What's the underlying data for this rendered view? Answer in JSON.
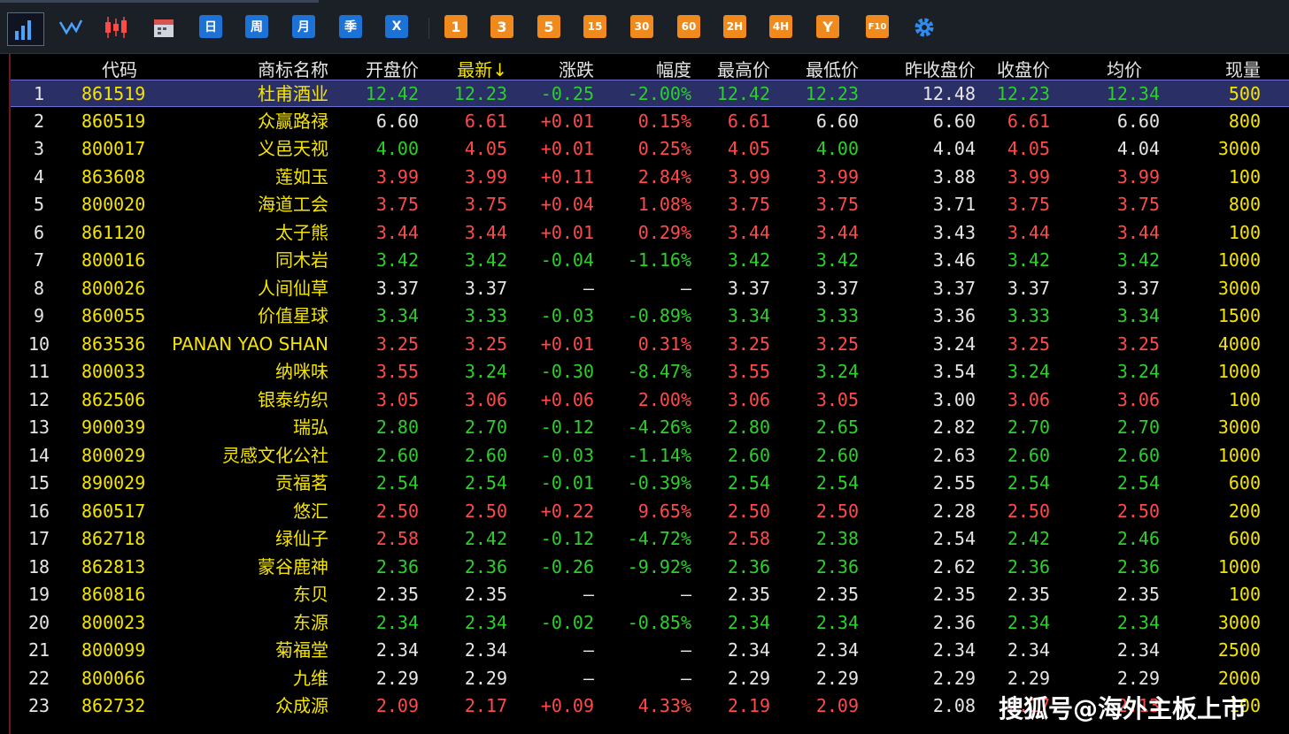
{
  "toolbar": {
    "buttons_blue": [
      "日",
      "周",
      "月",
      "季",
      "X"
    ],
    "buttons_orange": [
      "1",
      "3",
      "5",
      "15",
      "30",
      "60",
      "2H",
      "4H",
      "Y",
      "F10"
    ]
  },
  "headers": [
    "代码",
    "商标名称",
    "开盘价",
    "最新↓",
    "涨跌",
    "幅度",
    "最高价",
    "最低价",
    "昨收盘价",
    "收盘价",
    "均价",
    "现量"
  ],
  "colors": {
    "up": "#ff4a4a",
    "down": "#2bd02b",
    "flat": "#e6e6e6",
    "code": "#f5e400",
    "selected_bg": "#2a2f66"
  },
  "rows": [
    {
      "n": "1",
      "code": "861519",
      "name": "杜甫酒业",
      "open": "12.42",
      "last": "12.23",
      "chg": "-0.25",
      "pct": "-2.00%",
      "high": "12.42",
      "low": "12.23",
      "prev": "12.48",
      "close": "12.23",
      "avg": "12.34",
      "vol": "500",
      "open_c": "down",
      "last_c": "down",
      "chg_c": "down",
      "high_c": "down",
      "low_c": "down",
      "close_c": "down",
      "avg_c": "down"
    },
    {
      "n": "2",
      "code": "860519",
      "name": "众赢路禄",
      "open": "6.60",
      "last": "6.61",
      "chg": "+0.01",
      "pct": "0.15%",
      "high": "6.61",
      "low": "6.60",
      "prev": "6.60",
      "close": "6.61",
      "avg": "6.60",
      "vol": "800",
      "open_c": "flat",
      "last_c": "up",
      "chg_c": "up",
      "high_c": "up",
      "low_c": "flat",
      "close_c": "up",
      "avg_c": "flat"
    },
    {
      "n": "3",
      "code": "800017",
      "name": "义邑天视",
      "open": "4.00",
      "last": "4.05",
      "chg": "+0.01",
      "pct": "0.25%",
      "high": "4.05",
      "low": "4.00",
      "prev": "4.04",
      "close": "4.05",
      "avg": "4.04",
      "vol": "3000",
      "open_c": "down",
      "last_c": "up",
      "chg_c": "up",
      "high_c": "up",
      "low_c": "down",
      "close_c": "up",
      "avg_c": "flat"
    },
    {
      "n": "4",
      "code": "863608",
      "name": "莲如玉",
      "open": "3.99",
      "last": "3.99",
      "chg": "+0.11",
      "pct": "2.84%",
      "high": "3.99",
      "low": "3.99",
      "prev": "3.88",
      "close": "3.99",
      "avg": "3.99",
      "vol": "100",
      "open_c": "up",
      "last_c": "up",
      "chg_c": "up",
      "high_c": "up",
      "low_c": "up",
      "close_c": "up",
      "avg_c": "up"
    },
    {
      "n": "5",
      "code": "800020",
      "name": "海道工会",
      "open": "3.75",
      "last": "3.75",
      "chg": "+0.04",
      "pct": "1.08%",
      "high": "3.75",
      "low": "3.75",
      "prev": "3.71",
      "close": "3.75",
      "avg": "3.75",
      "vol": "800",
      "open_c": "up",
      "last_c": "up",
      "chg_c": "up",
      "high_c": "up",
      "low_c": "up",
      "close_c": "up",
      "avg_c": "up"
    },
    {
      "n": "6",
      "code": "861120",
      "name": "太子熊",
      "open": "3.44",
      "last": "3.44",
      "chg": "+0.01",
      "pct": "0.29%",
      "high": "3.44",
      "low": "3.44",
      "prev": "3.43",
      "close": "3.44",
      "avg": "3.44",
      "vol": "100",
      "open_c": "up",
      "last_c": "up",
      "chg_c": "up",
      "high_c": "up",
      "low_c": "up",
      "close_c": "up",
      "avg_c": "up"
    },
    {
      "n": "7",
      "code": "800016",
      "name": "同木岩",
      "open": "3.42",
      "last": "3.42",
      "chg": "-0.04",
      "pct": "-1.16%",
      "high": "3.42",
      "low": "3.42",
      "prev": "3.46",
      "close": "3.42",
      "avg": "3.42",
      "vol": "1000",
      "open_c": "down",
      "last_c": "down",
      "chg_c": "down",
      "high_c": "down",
      "low_c": "down",
      "close_c": "down",
      "avg_c": "down"
    },
    {
      "n": "8",
      "code": "800026",
      "name": "人间仙草",
      "open": "3.37",
      "last": "3.37",
      "chg": "—",
      "pct": "—",
      "high": "3.37",
      "low": "3.37",
      "prev": "3.37",
      "close": "3.37",
      "avg": "3.37",
      "vol": "3000",
      "open_c": "flat",
      "last_c": "flat",
      "chg_c": "flat",
      "high_c": "flat",
      "low_c": "flat",
      "close_c": "flat",
      "avg_c": "flat"
    },
    {
      "n": "9",
      "code": "860055",
      "name": "价值星球",
      "open": "3.34",
      "last": "3.33",
      "chg": "-0.03",
      "pct": "-0.89%",
      "high": "3.34",
      "low": "3.33",
      "prev": "3.36",
      "close": "3.33",
      "avg": "3.34",
      "vol": "1500",
      "open_c": "down",
      "last_c": "down",
      "chg_c": "down",
      "high_c": "down",
      "low_c": "down",
      "close_c": "down",
      "avg_c": "down"
    },
    {
      "n": "10",
      "code": "863536",
      "name": "PANAN YAO SHAN",
      "open": "3.25",
      "last": "3.25",
      "chg": "+0.01",
      "pct": "0.31%",
      "high": "3.25",
      "low": "3.25",
      "prev": "3.24",
      "close": "3.25",
      "avg": "3.25",
      "vol": "4000",
      "open_c": "up",
      "last_c": "up",
      "chg_c": "up",
      "high_c": "up",
      "low_c": "up",
      "close_c": "up",
      "avg_c": "up"
    },
    {
      "n": "11",
      "code": "800033",
      "name": "纳咪味",
      "open": "3.55",
      "last": "3.24",
      "chg": "-0.30",
      "pct": "-8.47%",
      "high": "3.55",
      "low": "3.24",
      "prev": "3.54",
      "close": "3.24",
      "avg": "3.24",
      "vol": "1000",
      "open_c": "up",
      "last_c": "down",
      "chg_c": "down",
      "high_c": "up",
      "low_c": "down",
      "close_c": "down",
      "avg_c": "down"
    },
    {
      "n": "12",
      "code": "862506",
      "name": "银泰纺织",
      "open": "3.05",
      "last": "3.06",
      "chg": "+0.06",
      "pct": "2.00%",
      "high": "3.06",
      "low": "3.05",
      "prev": "3.00",
      "close": "3.06",
      "avg": "3.06",
      "vol": "100",
      "open_c": "up",
      "last_c": "up",
      "chg_c": "up",
      "high_c": "up",
      "low_c": "up",
      "close_c": "up",
      "avg_c": "up"
    },
    {
      "n": "13",
      "code": "900039",
      "name": "瑞弘",
      "open": "2.80",
      "last": "2.70",
      "chg": "-0.12",
      "pct": "-4.26%",
      "high": "2.80",
      "low": "2.65",
      "prev": "2.82",
      "close": "2.70",
      "avg": "2.70",
      "vol": "3000",
      "open_c": "down",
      "last_c": "down",
      "chg_c": "down",
      "high_c": "down",
      "low_c": "down",
      "close_c": "down",
      "avg_c": "down"
    },
    {
      "n": "14",
      "code": "800029",
      "name": "灵感文化公社",
      "open": "2.60",
      "last": "2.60",
      "chg": "-0.03",
      "pct": "-1.14%",
      "high": "2.60",
      "low": "2.60",
      "prev": "2.63",
      "close": "2.60",
      "avg": "2.60",
      "vol": "1000",
      "open_c": "down",
      "last_c": "down",
      "chg_c": "down",
      "high_c": "down",
      "low_c": "down",
      "close_c": "down",
      "avg_c": "down"
    },
    {
      "n": "15",
      "code": "890029",
      "name": "贡福茗",
      "open": "2.54",
      "last": "2.54",
      "chg": "-0.01",
      "pct": "-0.39%",
      "high": "2.54",
      "low": "2.54",
      "prev": "2.55",
      "close": "2.54",
      "avg": "2.54",
      "vol": "600",
      "open_c": "down",
      "last_c": "down",
      "chg_c": "down",
      "high_c": "down",
      "low_c": "down",
      "close_c": "down",
      "avg_c": "down"
    },
    {
      "n": "16",
      "code": "860517",
      "name": "悠汇",
      "open": "2.50",
      "last": "2.50",
      "chg": "+0.22",
      "pct": "9.65%",
      "high": "2.50",
      "low": "2.50",
      "prev": "2.28",
      "close": "2.50",
      "avg": "2.50",
      "vol": "200",
      "open_c": "up",
      "last_c": "up",
      "chg_c": "up",
      "high_c": "up",
      "low_c": "up",
      "close_c": "up",
      "avg_c": "up"
    },
    {
      "n": "17",
      "code": "862718",
      "name": "绿仙子",
      "open": "2.58",
      "last": "2.42",
      "chg": "-0.12",
      "pct": "-4.72%",
      "high": "2.58",
      "low": "2.38",
      "prev": "2.54",
      "close": "2.42",
      "avg": "2.46",
      "vol": "600",
      "open_c": "up",
      "last_c": "down",
      "chg_c": "down",
      "high_c": "up",
      "low_c": "down",
      "close_c": "down",
      "avg_c": "down"
    },
    {
      "n": "18",
      "code": "862813",
      "name": "蒙谷鹿神",
      "open": "2.36",
      "last": "2.36",
      "chg": "-0.26",
      "pct": "-9.92%",
      "high": "2.36",
      "low": "2.36",
      "prev": "2.62",
      "close": "2.36",
      "avg": "2.36",
      "vol": "1000",
      "open_c": "down",
      "last_c": "down",
      "chg_c": "down",
      "high_c": "down",
      "low_c": "down",
      "close_c": "down",
      "avg_c": "down"
    },
    {
      "n": "19",
      "code": "860816",
      "name": "东贝",
      "open": "2.35",
      "last": "2.35",
      "chg": "—",
      "pct": "—",
      "high": "2.35",
      "low": "2.35",
      "prev": "2.35",
      "close": "2.35",
      "avg": "2.35",
      "vol": "100",
      "open_c": "flat",
      "last_c": "flat",
      "chg_c": "flat",
      "high_c": "flat",
      "low_c": "flat",
      "close_c": "flat",
      "avg_c": "flat"
    },
    {
      "n": "20",
      "code": "800023",
      "name": "东源",
      "open": "2.34",
      "last": "2.34",
      "chg": "-0.02",
      "pct": "-0.85%",
      "high": "2.34",
      "low": "2.34",
      "prev": "2.36",
      "close": "2.34",
      "avg": "2.34",
      "vol": "3000",
      "open_c": "down",
      "last_c": "down",
      "chg_c": "down",
      "high_c": "down",
      "low_c": "down",
      "close_c": "down",
      "avg_c": "down"
    },
    {
      "n": "21",
      "code": "800099",
      "name": "菊福堂",
      "open": "2.34",
      "last": "2.34",
      "chg": "—",
      "pct": "—",
      "high": "2.34",
      "low": "2.34",
      "prev": "2.34",
      "close": "2.34",
      "avg": "2.34",
      "vol": "2500",
      "open_c": "flat",
      "last_c": "flat",
      "chg_c": "flat",
      "high_c": "flat",
      "low_c": "flat",
      "close_c": "flat",
      "avg_c": "flat"
    },
    {
      "n": "22",
      "code": "800066",
      "name": "九维",
      "open": "2.29",
      "last": "2.29",
      "chg": "—",
      "pct": "—",
      "high": "2.29",
      "low": "2.29",
      "prev": "2.29",
      "close": "2.29",
      "avg": "2.29",
      "vol": "2000",
      "open_c": "flat",
      "last_c": "flat",
      "chg_c": "flat",
      "high_c": "flat",
      "low_c": "flat",
      "close_c": "flat",
      "avg_c": "flat"
    },
    {
      "n": "23",
      "code": "862732",
      "name": "众成源",
      "open": "2.09",
      "last": "2.17",
      "chg": "+0.09",
      "pct": "4.33%",
      "high": "2.19",
      "low": "2.09",
      "prev": "2.08",
      "close": "2.17",
      "avg": "2.13",
      "vol": "100",
      "open_c": "up",
      "last_c": "up",
      "chg_c": "up",
      "high_c": "up",
      "low_c": "up",
      "close_c": "up",
      "avg_c": "up"
    }
  ],
  "watermark": "搜狐号@海外主板上市"
}
